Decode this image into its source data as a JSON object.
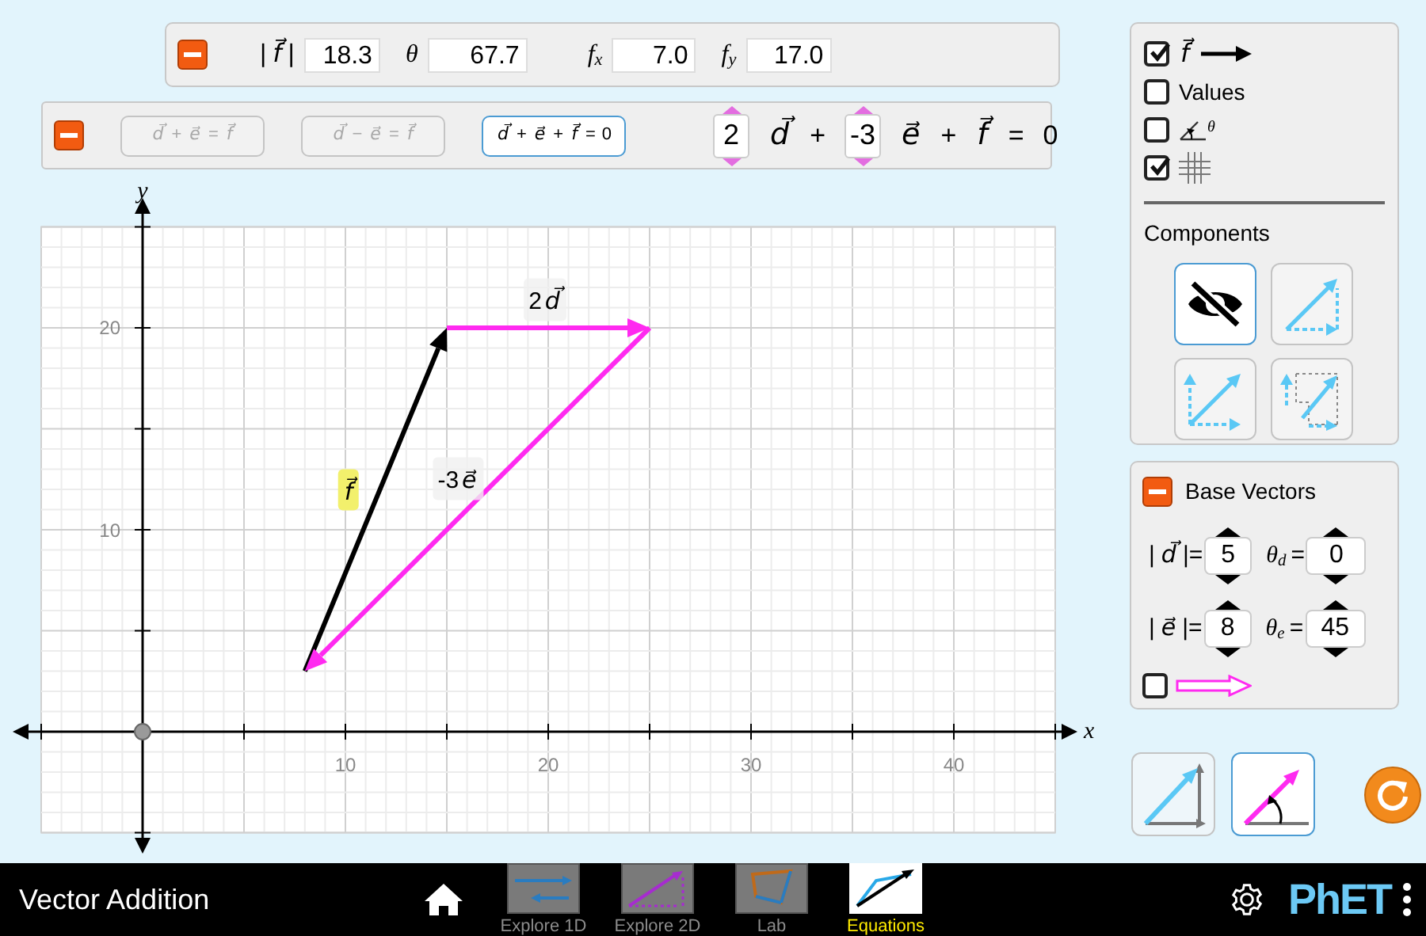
{
  "vector_values_panel": {
    "expanded": true,
    "fields": [
      {
        "label": [
          {
            "kind": "plain",
            "text": "|"
          },
          {
            "kind": "vector",
            "text": "f⃗"
          },
          {
            "kind": "plain",
            "text": "|"
          }
        ],
        "value": "18.3"
      },
      {
        "label": [
          {
            "kind": "italic",
            "text": "θ"
          }
        ],
        "value": "67.7"
      },
      {
        "label": [
          {
            "kind": "italic",
            "text": "f",
            "sub": "x"
          }
        ],
        "value": "7.0"
      },
      {
        "label": [
          {
            "kind": "italic",
            "text": "f",
            "sub": "y"
          }
        ],
        "value": "17.0"
      }
    ]
  },
  "equation_panel": {
    "expanded": true,
    "equation_types": [
      {
        "selected": false,
        "tokens": [
          {
            "kind": "vector",
            "text": "d⃗"
          },
          {
            "kind": "plain",
            "text": "+"
          },
          {
            "kind": "vector",
            "text": "e⃗"
          },
          {
            "kind": "plain",
            "text": "="
          },
          {
            "kind": "vector",
            "text": "f⃗"
          }
        ]
      },
      {
        "selected": false,
        "tokens": [
          {
            "kind": "vector",
            "text": "d⃗"
          },
          {
            "kind": "plain",
            "text": "−"
          },
          {
            "kind": "vector",
            "text": "e⃗"
          },
          {
            "kind": "plain",
            "text": "="
          },
          {
            "kind": "vector",
            "text": "f⃗"
          }
        ]
      },
      {
        "selected": true,
        "tokens": [
          {
            "kind": "vector",
            "text": "d⃗"
          },
          {
            "kind": "plain",
            "text": "+"
          },
          {
            "kind": "vector",
            "text": "e⃗"
          },
          {
            "kind": "plain",
            "text": "+"
          },
          {
            "kind": "vector",
            "text": "f⃗"
          },
          {
            "kind": "plain",
            "text": "="
          },
          {
            "kind": "plain",
            "text": "0"
          }
        ]
      }
    ],
    "terms": [
      {
        "kind": "coefficient",
        "text": "2"
      },
      {
        "kind": "vector",
        "text": "d⃗"
      },
      {
        "kind": "operator",
        "text": "+"
      },
      {
        "kind": "coefficient",
        "text": "-3"
      },
      {
        "kind": "vector",
        "text": "e⃗"
      },
      {
        "kind": "operator",
        "text": "+"
      },
      {
        "kind": "vector",
        "text": "f⃗"
      },
      {
        "kind": "operator",
        "text": "="
      },
      {
        "kind": "operator",
        "text": "0"
      }
    ]
  },
  "graph": {
    "x_axis_label": "x",
    "y_axis_label": "y",
    "x_ticks": [
      "10",
      "20",
      "30",
      "40"
    ],
    "y_ticks": [
      "20",
      "10"
    ],
    "vectors": [
      {
        "kind": "sum",
        "highlighted": true,
        "label": [
          {
            "kind": "vector",
            "text": "f⃗"
          }
        ]
      },
      {
        "kind": "base",
        "highlighted": false,
        "label": [
          {
            "kind": "plain",
            "text": "2"
          },
          {
            "kind": "vector",
            "text": "d⃗"
          }
        ]
      },
      {
        "kind": "base",
        "highlighted": false,
        "label": [
          {
            "kind": "plain",
            "text": "-3"
          },
          {
            "kind": "vector",
            "text": "e⃗"
          }
        ]
      }
    ]
  },
  "display_options": {
    "checkboxes": [
      {
        "kind": "sum_vector",
        "checked": true,
        "symbol": "f⃗"
      },
      {
        "kind": "text",
        "checked": false,
        "label": "Values"
      },
      {
        "kind": "angle",
        "checked": false,
        "symbol": "θ"
      },
      {
        "kind": "grid",
        "checked": true
      }
    ],
    "components_title": "Components",
    "component_styles": [
      {
        "kind": "hidden",
        "selected": true
      },
      {
        "kind": "triangle",
        "selected": false
      },
      {
        "kind": "parallelogram",
        "selected": false
      },
      {
        "kind": "projection",
        "selected": false
      }
    ]
  },
  "base_vectors_panel": {
    "expanded": true,
    "title": "Base Vectors",
    "rows": [
      [
        {
          "label": [
            {
              "kind": "plain",
              "text": "|"
            },
            {
              "kind": "vector",
              "text": "d⃗"
            },
            {
              "kind": "plain",
              "text": "|="
            }
          ],
          "value": "5"
        },
        {
          "label": [
            {
              "kind": "italic",
              "text": "θ",
              "sub": "d"
            },
            {
              "kind": "plain",
              "text": "="
            }
          ],
          "value": "0"
        }
      ],
      [
        {
          "label": [
            {
              "kind": "plain",
              "text": "|"
            },
            {
              "kind": "vector",
              "text": "e⃗"
            },
            {
              "kind": "plain",
              "text": "|="
            }
          ],
          "value": "8"
        },
        {
          "label": [
            {
              "kind": "italic",
              "text": "θ",
              "sub": "e"
            },
            {
              "kind": "plain",
              "text": "="
            }
          ],
          "value": "45"
        }
      ]
    ],
    "show_base_vectors": {
      "checked": false
    }
  },
  "coordinate_views": [
    {
      "kind": "cartesian",
      "selected": false
    },
    {
      "kind": "polar",
      "selected": true
    }
  ],
  "nav_bar": {
    "title": "Vector Addition",
    "screens": [
      {
        "label": "Explore 1D",
        "selected": false
      },
      {
        "label": "Explore 2D",
        "selected": false
      },
      {
        "label": "Lab",
        "selected": false
      },
      {
        "label": "Equations",
        "selected": true
      }
    ],
    "brand": "PhET"
  }
}
